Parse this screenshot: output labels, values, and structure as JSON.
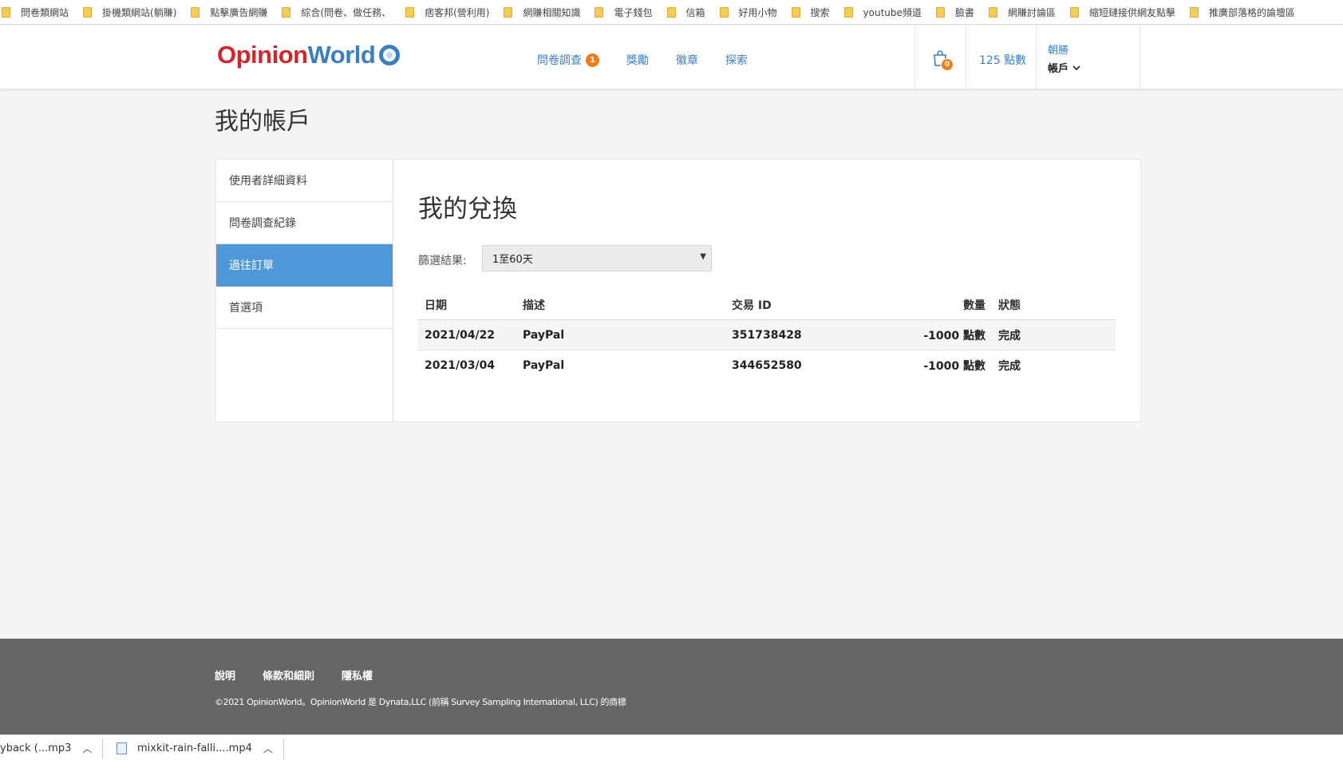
{
  "bookmarks": [
    "問卷類網站",
    "掛機類網站(躺賺)",
    "點擊廣告網賺",
    "綜合(問卷、做任務、",
    "痞客邦(營利用)",
    "網賺相關知識",
    "電子錢包",
    "信箱",
    "好用小物",
    "搜索",
    "youtube頻道",
    "臉書",
    "網賺討論區",
    "縮短鏈接供網友點擊",
    "推廣部落格的論壇區"
  ],
  "header": {
    "logo_opinion": "Opinion",
    "logo_world": "World",
    "nav": [
      {
        "label": "問卷調查",
        "badge": "1"
      },
      {
        "label": "獎勵"
      },
      {
        "label": "徽章"
      },
      {
        "label": "探索"
      }
    ],
    "cart_count": "0",
    "points": "125 點數",
    "user_name": "朝勝",
    "account_label": "帳戶"
  },
  "page": {
    "title": "我的帳戶"
  },
  "sidebar": {
    "items": [
      {
        "label": "使用者詳細資料"
      },
      {
        "label": "問卷調查紀錄"
      },
      {
        "label": "過往訂單",
        "active": true
      },
      {
        "label": "首選項"
      }
    ]
  },
  "main": {
    "title": "我的兌換",
    "filter_label": "篩選結果:",
    "filter_value": "1至60天"
  },
  "table": {
    "headers": [
      "日期",
      "描述",
      "交易 ID",
      "數量",
      "狀態"
    ],
    "rows": [
      [
        "2021/04/22",
        "PayPal",
        "351738428",
        "-1000 點數",
        "完成"
      ],
      [
        "2021/03/04",
        "PayPal",
        "344652580",
        "-1000 點數",
        "完成"
      ]
    ]
  },
  "footer": {
    "links": [
      "說明",
      "條款和細則",
      "隱私權"
    ],
    "copyright": "©2021 OpinionWorld。OpinionWorld 是 Dynata,LLC (前稱 Survey Sampling International, LLC) 的商標"
  },
  "downloads": [
    {
      "name": "yback (...mp3",
      "icon": "audio-file-icon"
    },
    {
      "name": "mixkit-rain-falli....mp4",
      "icon": "video-file-icon"
    }
  ],
  "colors": {
    "brand_red": "#d2262f",
    "brand_blue": "#3c7fc1",
    "active_item": "#4f97d6",
    "badge_orange": "#ef7d1a",
    "footer_bg": "#666666"
  }
}
